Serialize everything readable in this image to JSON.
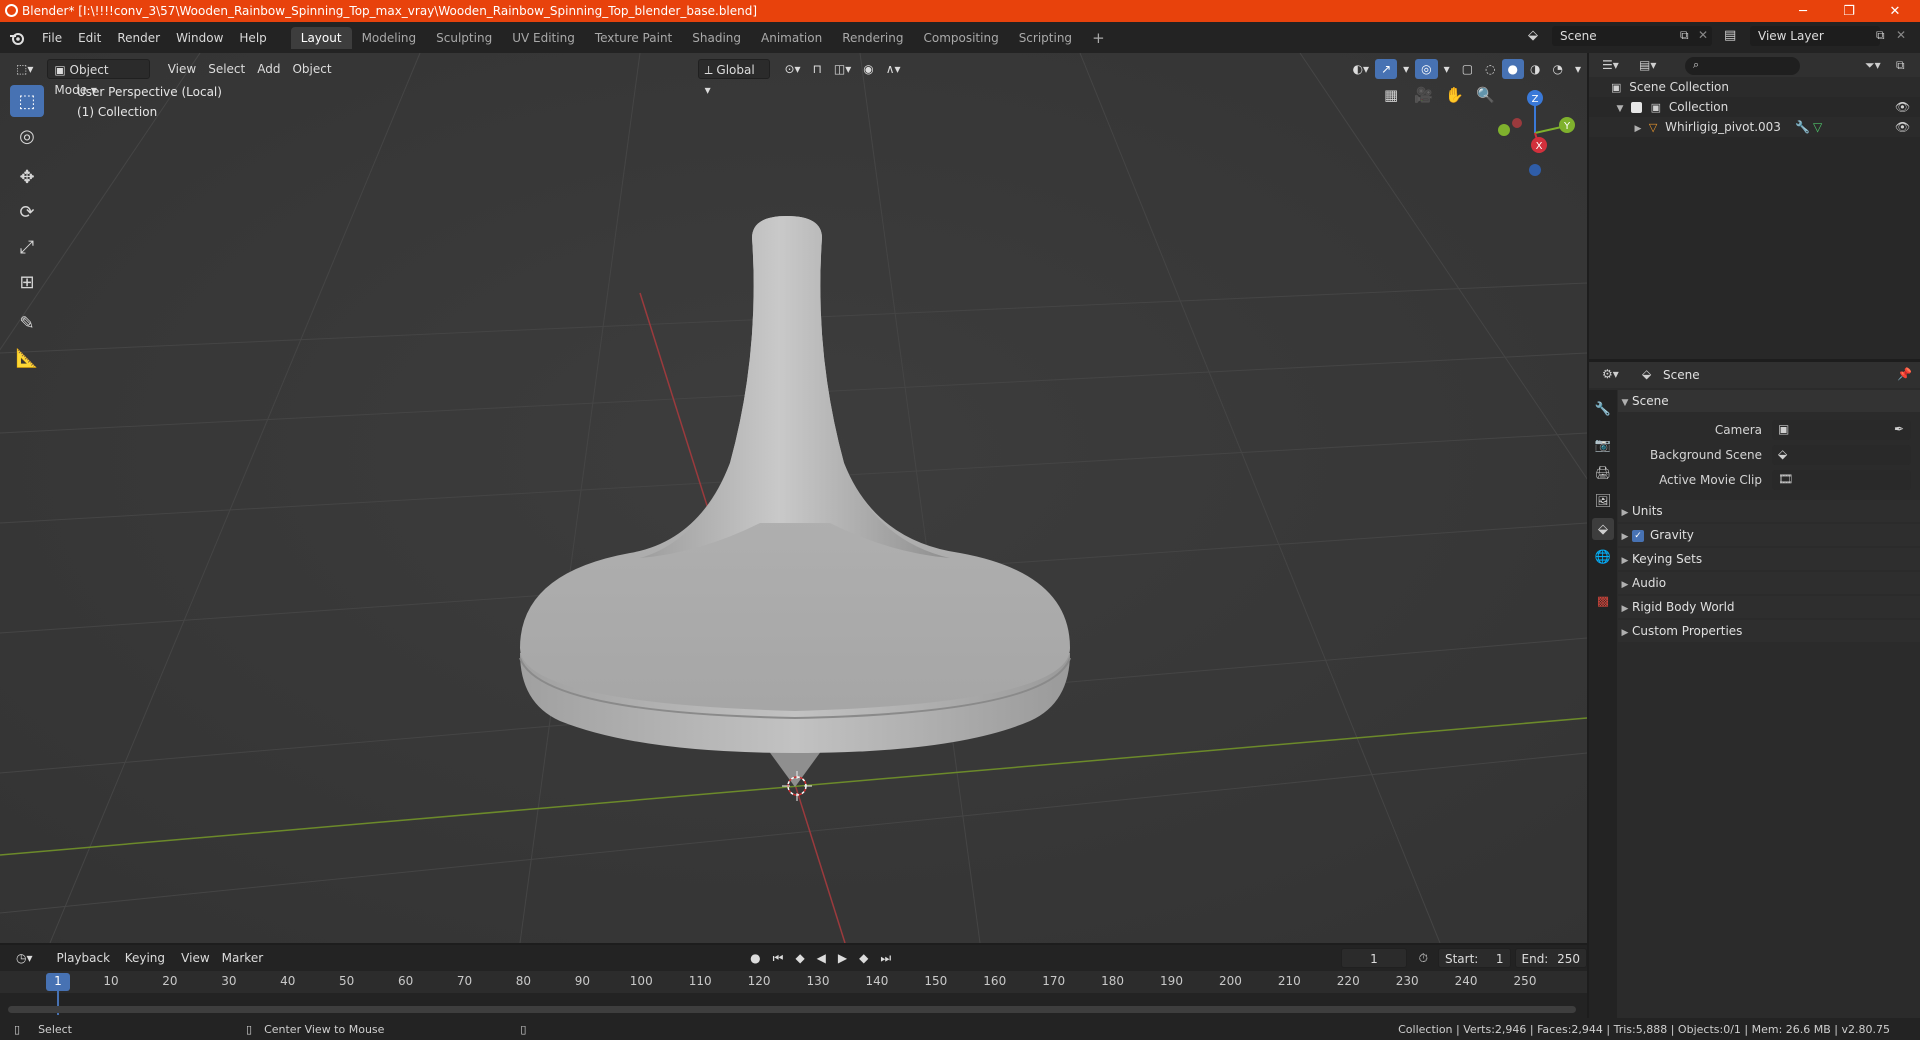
{
  "window": {
    "title": "Blender* [I:\\!!!!conv_3\\57\\Wooden_Rainbow_Spinning_Top_max_vray\\Wooden_Rainbow_Spinning_Top_blender_base.blend]",
    "minimize": "─",
    "maximize": "❐",
    "close": "✕"
  },
  "menubar": {
    "items": [
      "File",
      "Edit",
      "Render",
      "Window",
      "Help"
    ],
    "workspaces": [
      "Layout",
      "Modeling",
      "Sculpting",
      "UV Editing",
      "Texture Paint",
      "Shading",
      "Animation",
      "Rendering",
      "Compositing",
      "Scripting"
    ],
    "active_workspace": "Layout",
    "add_tab": "+",
    "scene": "Scene",
    "view_layer": "View Layer"
  },
  "viewport": {
    "mode": "Object Mode",
    "menus": [
      "View",
      "Select",
      "Add",
      "Object"
    ],
    "orientation": "Global",
    "overlay_line1": "User Perspective (Local)",
    "overlay_line2": "(1) Collection",
    "gizmo": {
      "z": "Z",
      "y": "Y",
      "x": "X"
    }
  },
  "outliner": {
    "search_placeholder": "",
    "root": "Scene Collection",
    "collection": "Collection",
    "object": "Whirligig_pivot.003"
  },
  "properties": {
    "header": "Scene",
    "panel_title": "Scene",
    "fields": [
      {
        "label": "Camera"
      },
      {
        "label": "Background Scene"
      },
      {
        "label": "Active Movie Clip"
      }
    ],
    "sections": [
      "Units",
      "Gravity",
      "Keying Sets",
      "Audio",
      "Rigid Body World",
      "Custom Properties"
    ],
    "gravity_checked": true
  },
  "timeline": {
    "menus": [
      "Playback",
      "Keying",
      "View",
      "Marker"
    ],
    "current_frame": "1",
    "start_label": "Start:",
    "start": "1",
    "end_label": "End:",
    "end": "250",
    "ticks": [
      "1",
      "10",
      "20",
      "30",
      "40",
      "50",
      "60",
      "70",
      "80",
      "90",
      "100",
      "110",
      "120",
      "130",
      "140",
      "150",
      "160",
      "170",
      "180",
      "190",
      "200",
      "210",
      "220",
      "230",
      "240",
      "250"
    ]
  },
  "statusbar": {
    "left": "Select",
    "middle": "Center View to Mouse",
    "right": "Collection | Verts:2,946 | Faces:2,944 | Tris:5,888 | Objects:0/1 | Mem: 26.6 MB | v2.80.75"
  },
  "colors": {
    "titlebar": "#e8420c",
    "accent": "#4772b3",
    "x_axis": "#d2303c",
    "y_axis": "#7fb12d",
    "z_axis": "#3a79d8"
  }
}
